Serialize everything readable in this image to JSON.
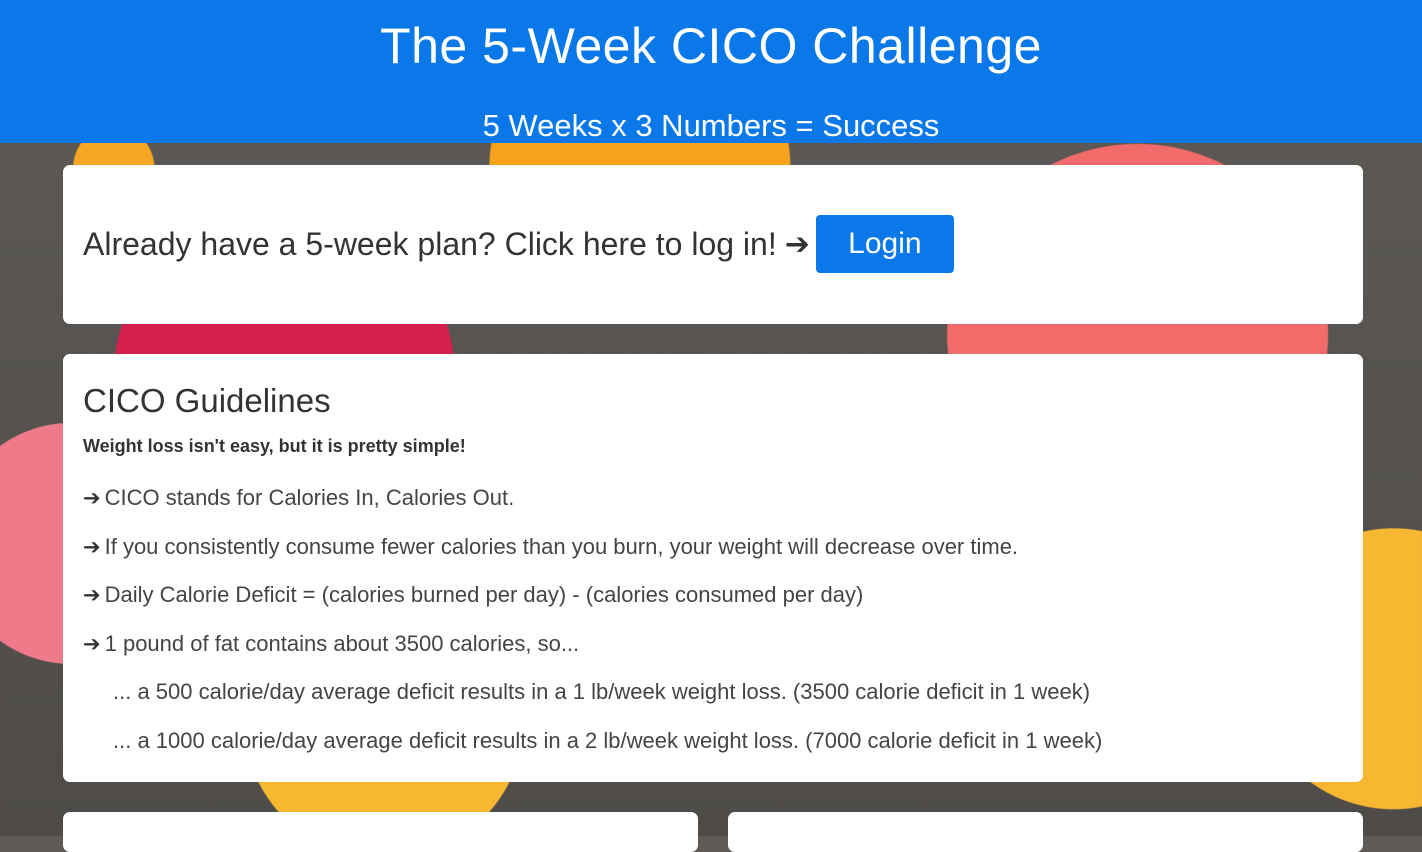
{
  "header": {
    "title": "The 5-Week CICO Challenge",
    "subtitle": "5 Weeks x 3 Numbers = Success"
  },
  "login": {
    "prompt": "Already have a 5-week plan? Click here to log in!",
    "arrow_icon": "arrow-right-icon",
    "button_label": "Login"
  },
  "guidelines": {
    "title": "CICO Guidelines",
    "intro": "Weight loss isn't easy, but it is pretty simple!",
    "arrow_glyph": "➔",
    "items": [
      "CICO stands for Calories In, Calories Out.",
      "If you consistently consume fewer calories than you burn, your weight will decrease over time.",
      "Daily Calorie Deficit = (calories burned per day) - (calories consumed per day)",
      "1 pound of fat contains about 3500 calories, so..."
    ],
    "subitems": [
      "... a 500 calorie/day average deficit results in a 1 lb/week weight loss. (3500 calorie deficit in 1 week)",
      "... a 1000 calorie/day average deficit results in a 2 lb/week weight loss. (7000 calorie deficit in 1 week)"
    ]
  },
  "colors": {
    "primary": "#0a78e9",
    "card": "#ffffff",
    "text": "#333333"
  }
}
